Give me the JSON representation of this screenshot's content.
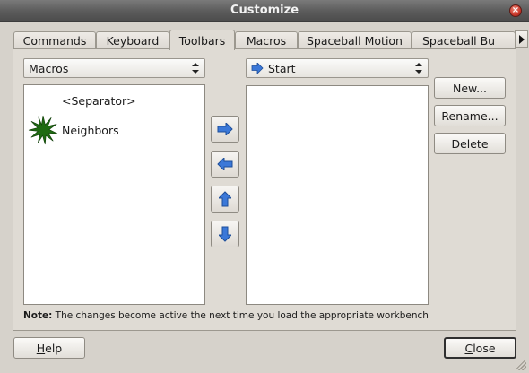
{
  "window": {
    "title": "Customize",
    "close_symbol": "×"
  },
  "tabs": [
    {
      "label": "Commands",
      "active": false
    },
    {
      "label": "Keyboard",
      "active": false
    },
    {
      "label": "Toolbars",
      "active": true
    },
    {
      "label": "Macros",
      "active": false
    },
    {
      "label": "Spaceball Motion",
      "active": false
    },
    {
      "label": "Spaceball Bu",
      "active": false
    }
  ],
  "left_panel": {
    "workbench_selected": "Macros",
    "items": [
      {
        "label": "<Separator>",
        "icon": "none"
      },
      {
        "label": "Neighbors",
        "icon": "green-starburst-icon"
      }
    ]
  },
  "right_panel": {
    "toolbar_selected": "Start",
    "toolbar_icon": "blue-right-arrow-icon",
    "items": []
  },
  "move_buttons": [
    "right-arrow-icon",
    "left-arrow-icon",
    "up-arrow-icon",
    "down-arrow-icon"
  ],
  "side_buttons": {
    "new": "New...",
    "rename": "Rename...",
    "delete": "Delete"
  },
  "note": {
    "prefix": "Note:",
    "text": " The changes become active the next time you load the appropriate workbench"
  },
  "footer": {
    "help": {
      "label": "Help",
      "mnemonic": "H",
      "rest": "elp"
    },
    "close": {
      "label": "Close",
      "mnemonic": "C",
      "rest": "lose"
    }
  },
  "colors": {
    "accent_blue": "#3b78d8",
    "star_green": "#1f6b12"
  }
}
